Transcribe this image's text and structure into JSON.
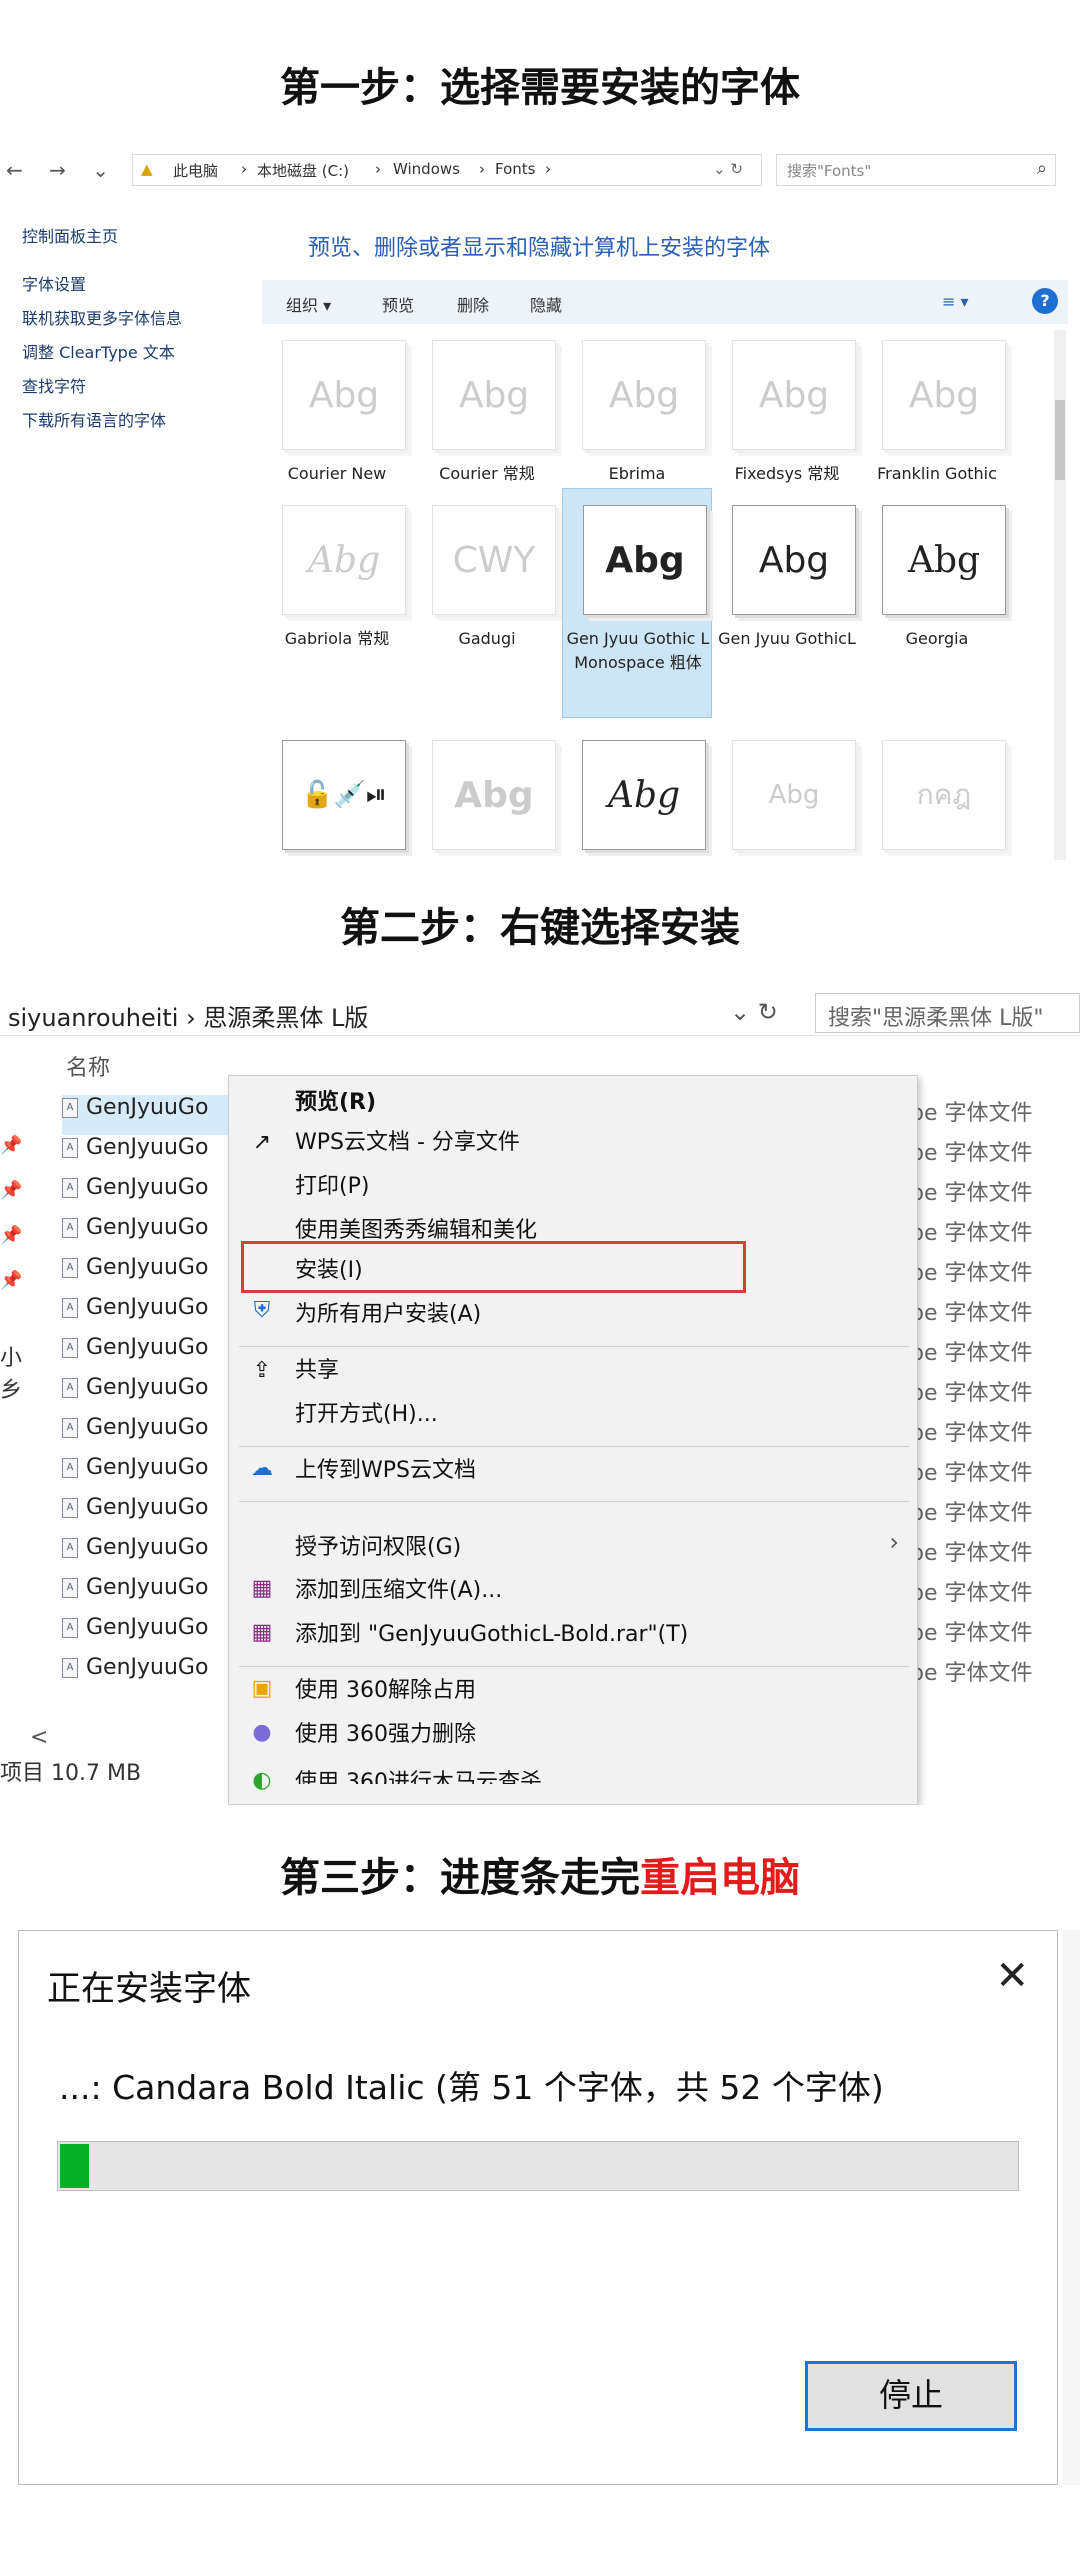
{
  "steps": {
    "step1": "第一步：选择需要安装的字体",
    "step2": "第二步：右键选择安装",
    "step3_a": "第三步：进度条走完",
    "step3_b": "重启电脑"
  },
  "panel1": {
    "nav_arrows": "← → ⌄ ↑",
    "path": {
      "p1": "此电脑",
      "p2": "本地磁盘 (C:)",
      "p3": "Windows",
      "p4": "Fonts",
      "sep": "›",
      "ctl": "⌄ ↻"
    },
    "search_placeholder": "搜索\"Fonts\"",
    "left_nav": [
      "控制面板主页",
      "字体设置",
      "联机获取更多字体信息",
      "调整 ClearType 文本",
      "查找字符",
      "下载所有语言的字体"
    ],
    "heading": "预览、删除或者显示和隐藏计算机上安装的字体",
    "toolbar": {
      "organize": "组织 ▾",
      "preview": "预览",
      "delete": "删除",
      "hide": "隐藏",
      "view": "≡ ▾",
      "help": "?"
    },
    "fonts": [
      {
        "sample": "Abg",
        "label": "Courier New",
        "style": "light"
      },
      {
        "sample": "Abg",
        "label": "Courier 常规",
        "style": "light"
      },
      {
        "sample": "Abg",
        "label": "Ebrima",
        "style": "light"
      },
      {
        "sample": "Abg",
        "label": "Fixedsys 常规",
        "style": "light"
      },
      {
        "sample": "Abg",
        "label": "Franklin Gothic",
        "style": "light"
      },
      {
        "sample": "Abg",
        "label": "Gabriola 常规",
        "style": "light"
      },
      {
        "sample": "CWY",
        "label": "Gadugi",
        "style": "light"
      },
      {
        "sample": "Abg",
        "label": "Gen Jyuu Gothic L Monospace 粗体",
        "style": "dark",
        "selected": true
      },
      {
        "sample": "Abg",
        "label": "Gen Jyuu GothicL",
        "style": "dark"
      },
      {
        "sample": "Abg",
        "label": "Georgia",
        "style": "dark"
      },
      {
        "sample": "🔓💉⏯",
        "label": "",
        "style": "dark"
      },
      {
        "sample": "Abg",
        "label": "",
        "style": "light"
      },
      {
        "sample": "Abg",
        "label": "",
        "style": "dark"
      },
      {
        "sample": "Abg",
        "label": "",
        "style": "light"
      },
      {
        "sample": "กคฎ",
        "label": "",
        "style": "light"
      }
    ]
  },
  "panel2": {
    "path": "siyuanrouheiti  ›  思源柔黑体 L版",
    "ctl": "⌄ ↻",
    "search": "搜索\"思源柔黑体 L版\"",
    "col_name": "名称",
    "file_name": "GenJyuuGo",
    "file_type": "pe 字体文件",
    "left_label": "小乡",
    "status": "项目  10.7 MB",
    "scroll_left": "<",
    "menu": {
      "preview": "预览(R)",
      "wps_share": "WPS云文档 - 分享文件",
      "print": "打印(P)",
      "meitu": "使用美图秀秀编辑和美化",
      "install": "安装(I)",
      "install_all": "为所有用户安装(A)",
      "share": "共享",
      "open_with": "打开方式(H)...",
      "upload_wps": "上传到WPS云文档",
      "grant_access": "授予访问权限(G)",
      "add_archive": "添加到压缩文件(A)...",
      "add_rar": "添加到 \"GenJyuuGothicL-Bold.rar\"(T)",
      "unlock360": "使用 360解除占用",
      "delete360": "使用 360强力删除",
      "cut360": "使用 360进行木马云查杀"
    }
  },
  "panel3": {
    "dialog_title": "正在安装字体",
    "close": "✕",
    "message": "...: Candara Bold Italic (第 51 个字体，共 52 个字体)",
    "progress": 0.03,
    "stop": "停止"
  },
  "colors": {
    "accent_red": "#e31b1b",
    "progress_green": "#06b025",
    "link_blue": "#2a60b5"
  }
}
